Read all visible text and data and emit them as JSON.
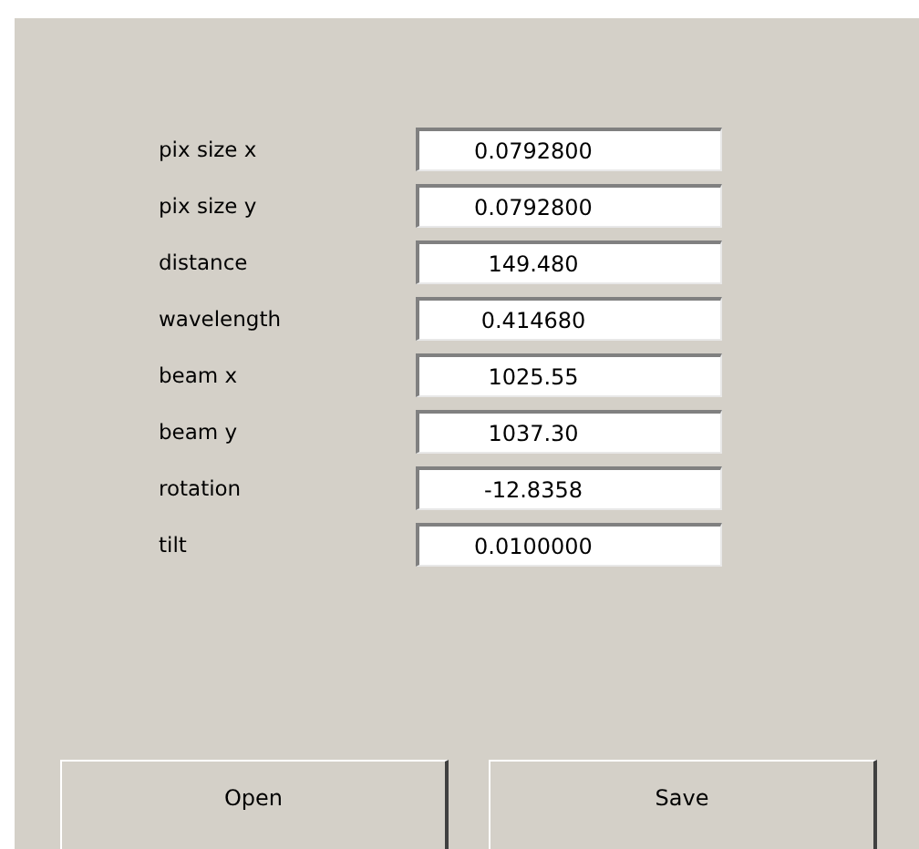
{
  "fields": [
    {
      "label": "pix size x",
      "value": "0.0792800"
    },
    {
      "label": "pix size y",
      "value": "0.0792800"
    },
    {
      "label": "distance",
      "value": "149.480"
    },
    {
      "label": "wavelength",
      "value": "0.414680"
    },
    {
      "label": "beam x",
      "value": "1025.55"
    },
    {
      "label": "beam y",
      "value": "1037.30"
    },
    {
      "label": "rotation",
      "value": "-12.8358"
    },
    {
      "label": "tilt",
      "value": "0.0100000"
    }
  ],
  "buttons": [
    "Open",
    "Save"
  ]
}
